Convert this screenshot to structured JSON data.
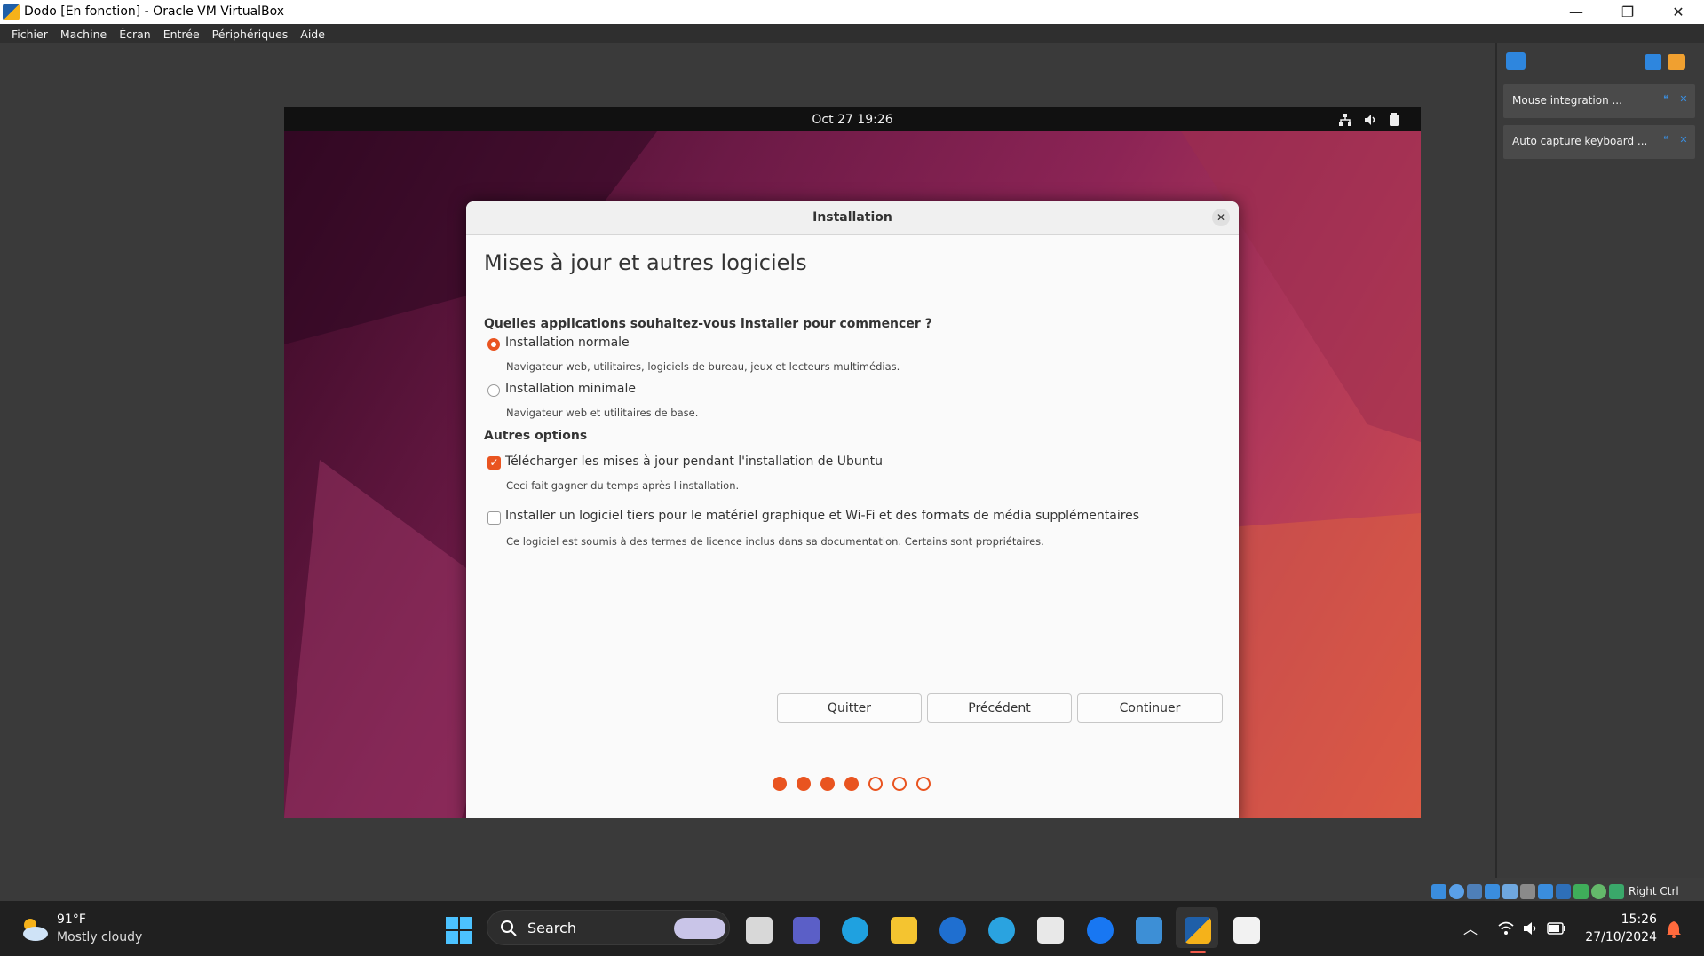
{
  "window": {
    "title": "Dodo [En fonction] - Oracle VM VirtualBox",
    "controls": [
      "—",
      "❐",
      "✕"
    ]
  },
  "menu": [
    "Fichier",
    "Machine",
    "Écran",
    "Entrée",
    "Périphériques",
    "Aide"
  ],
  "guest": {
    "clock": "Oct 27  19:26",
    "dialog": {
      "title": "Installation",
      "close": "✕",
      "heading": "Mises à jour et autres logiciels",
      "question": "Quelles applications souhaitez-vous installer pour commencer ?",
      "options": [
        {
          "label": "Installation normale",
          "desc": "Navigateur web, utilitaires, logiciels de bureau, jeux et lecteurs multimédias.",
          "selected": true
        },
        {
          "label": "Installation minimale",
          "desc": "Navigateur web et utilitaires de base.",
          "selected": false
        }
      ],
      "other_title": "Autres options",
      "checks": [
        {
          "label": "Télécharger les mises à jour pendant l'installation de Ubuntu",
          "desc": "Ceci fait gagner du temps après l'installation.",
          "checked": true
        },
        {
          "label": "Installer un logiciel tiers pour le matériel graphique et Wi-Fi et des formats de média supplémentaires",
          "desc": "Ce logiciel est soumis à des termes de licence inclus dans sa documentation. Certains sont propriétaires.",
          "checked": false
        }
      ],
      "buttons": {
        "quit": "Quitter",
        "back": "Précédent",
        "continue": "Continuer"
      },
      "progress": {
        "completed": 4,
        "total": 7
      },
      "accent": "#e95420"
    }
  },
  "notifications": [
    {
      "text": "Mouse integration ..."
    },
    {
      "text": "Auto capture keyboard ..."
    }
  ],
  "statusbar": {
    "host_key": "Right Ctrl"
  },
  "taskbar": {
    "weather": {
      "temp": "91°F",
      "desc": "Mostly cloudy"
    },
    "search": "Search",
    "time": "15:26",
    "date": "27/10/2024"
  }
}
